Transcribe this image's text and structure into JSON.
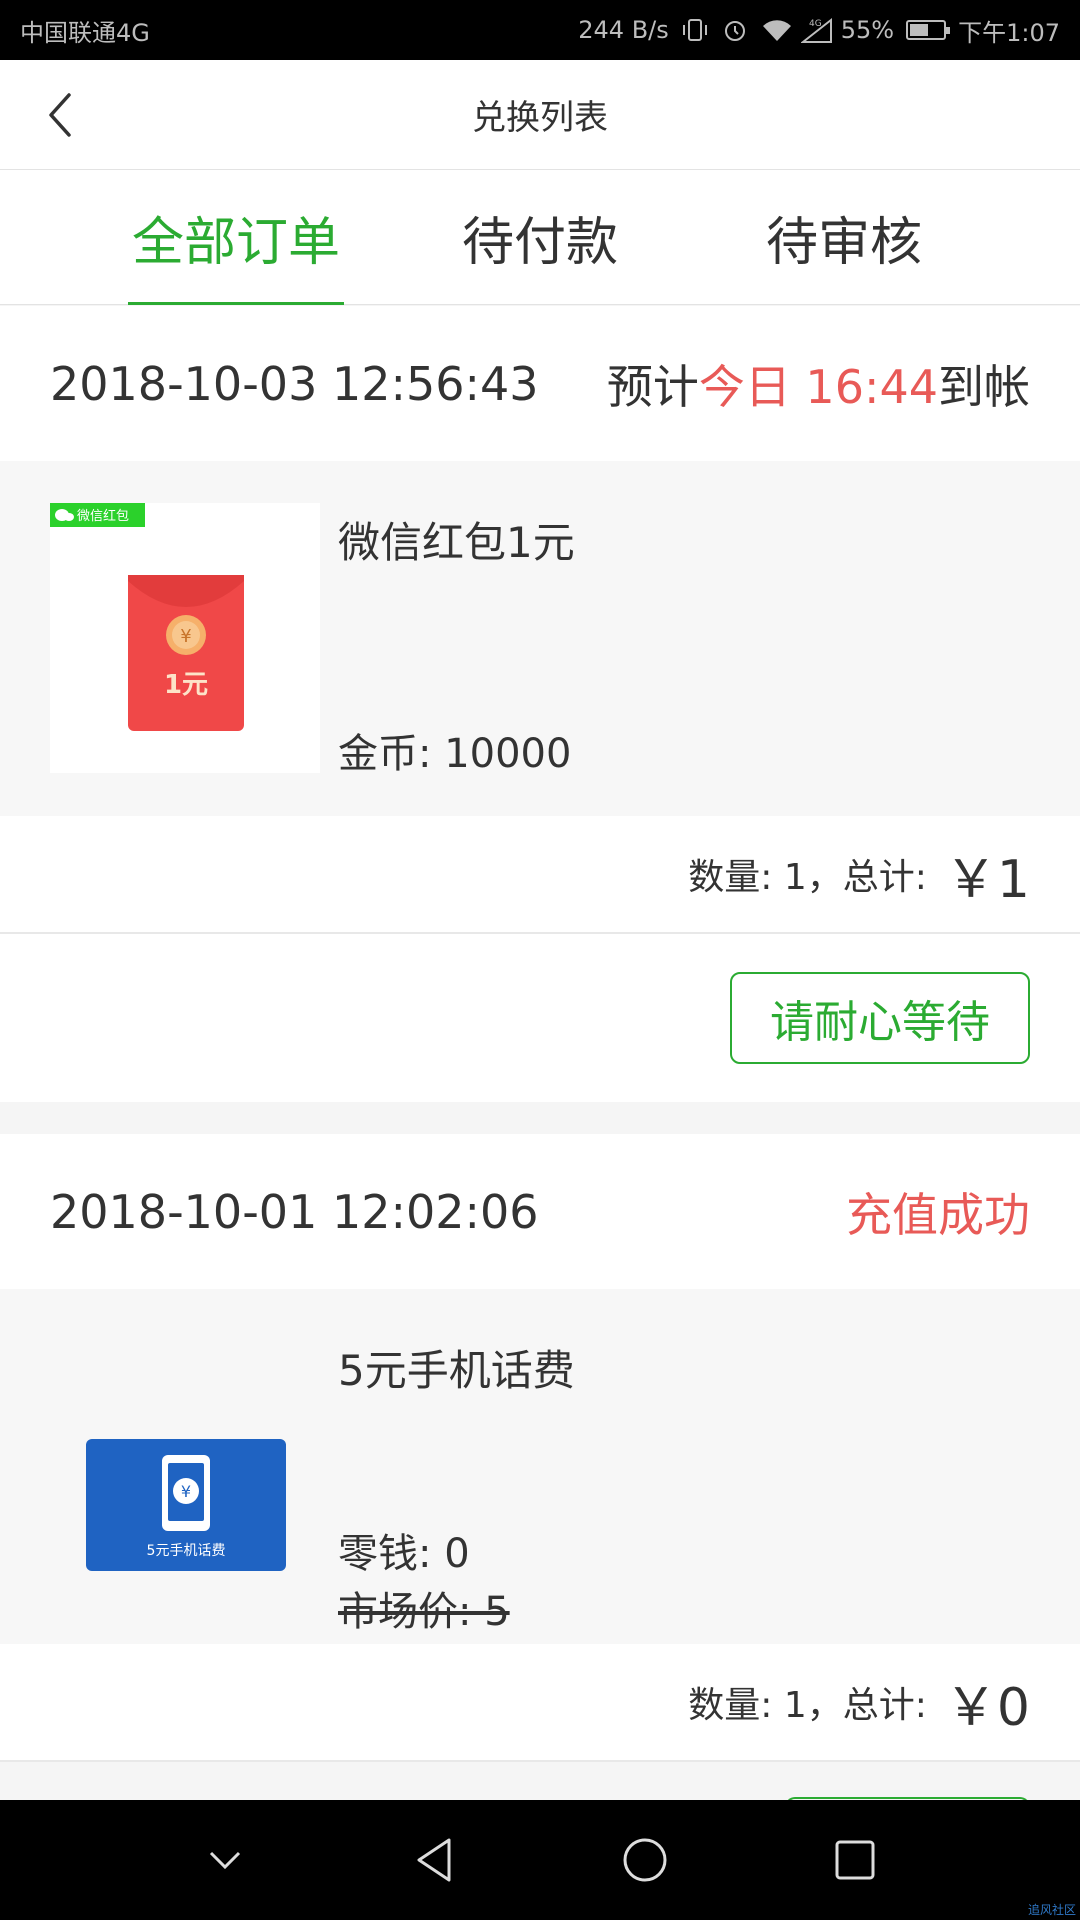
{
  "status_bar": {
    "carrier": "中国联通4G",
    "speed": "244 B/s",
    "network": "4G",
    "battery": "55%",
    "battery_level": 0.55,
    "time": "下午1:07"
  },
  "header": {
    "title": "兑换列表",
    "back_icon": "chevron-left-icon"
  },
  "tabs": [
    {
      "label": "全部订单",
      "active": true
    },
    {
      "label": "待付款",
      "active": false
    },
    {
      "label": "待审核",
      "active": false
    }
  ],
  "orders": [
    {
      "time": "2018-10-03 12:56:43",
      "status_prefix": "预计",
      "status_highlight": "今日 16:44",
      "status_suffix": "到帐",
      "item_name": "微信红包1元",
      "thumb_badge": "微信红包",
      "thumb_label": "1元",
      "price_line": "金币: 10000",
      "summary": "数量: 1，总计:",
      "total": "￥1",
      "action_label": "请耐心等待"
    },
    {
      "time": "2018-10-01 12:02:06",
      "status": "充值成功",
      "item_name": "5元手机话费",
      "thumb_label": "5元手机话费",
      "price_line": "零钱: 0",
      "market_price": "市场价: 5",
      "summary": "数量: 1，总计:",
      "total": "￥0"
    }
  ],
  "colors": {
    "accent": "#2bab32",
    "highlight_red": "#e85a57",
    "text": "#333333"
  },
  "nav_bar": {
    "icons": [
      "chevron-down-icon",
      "back-triangle-icon",
      "home-circle-icon",
      "recents-square-icon"
    ]
  },
  "watermark": "追风社区"
}
